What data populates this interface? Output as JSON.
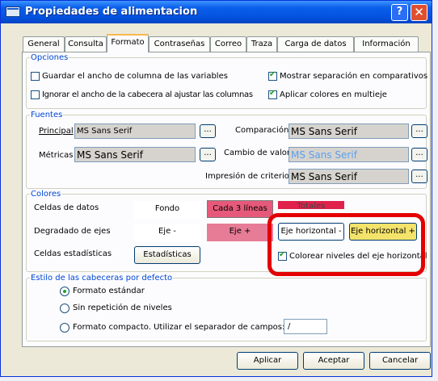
{
  "window": {
    "title": "Propiedades de alimentacion",
    "help_label": "?",
    "close_label": "✕"
  },
  "tabs": [
    "General",
    "Consulta",
    "Formato",
    "Contraseñas",
    "Correo",
    "Traza",
    "Carga de datos",
    "Información"
  ],
  "active_tab": "Formato",
  "opciones": {
    "legend": "Opciones",
    "guardar_ancho": {
      "label": "Guardar el ancho de columna de las variables",
      "checked": false
    },
    "mostrar_sep": {
      "label": "Mostrar separación en comparativos",
      "checked": true
    },
    "ignorar_ancho": {
      "label": "Ignorar el ancho de la cabecera al ajustar las columnas",
      "checked": false
    },
    "aplicar_colores": {
      "label": "Aplicar colores en multieje",
      "checked": true
    }
  },
  "fuentes": {
    "legend": "Fuentes",
    "principal": {
      "label": "Principal",
      "value": "MS Sans Serif"
    },
    "comparacion": {
      "label": "Comparación",
      "value": "MS Sans Serif"
    },
    "metricas": {
      "label": "Métricas",
      "value": "MS Sans Serif"
    },
    "cambio_valor": {
      "label": "Cambio de valor",
      "value": "MS Sans Serif"
    },
    "impresion": {
      "label": "Impresión de criterios",
      "value": "MS Sans Serif"
    },
    "dots_label": "..."
  },
  "colores": {
    "legend": "Colores",
    "celdas_datos": "Celdas de datos",
    "degradado_ejes": "Degradado de ejes",
    "celdas_estadisticas": "Celdas estadísticas",
    "fondo": {
      "label": "Fondo",
      "color": "#ffffff"
    },
    "cada3": {
      "label": "Cada 3 líneas",
      "color": "#e6597a"
    },
    "totales": {
      "label": "Totales",
      "color": "#e0214b"
    },
    "eje_minus": {
      "label": "Eje -",
      "color": "#ffffff"
    },
    "eje_plus": {
      "label": "Eje +",
      "color": "#e77c97"
    },
    "eje_h_minus": {
      "label": "Eje horizontal -",
      "color": "#ffffff"
    },
    "eje_h_plus": {
      "label": "Eje horizontal +",
      "color": "#f4e36a"
    },
    "estadisticas": "Estadísticas",
    "colorear": {
      "label": "Colorear niveles del eje horizontal",
      "checked": true
    }
  },
  "estilo": {
    "legend": "Estilo de las cabeceras por defecto",
    "opt1": {
      "label": "Formato estándar",
      "selected": true
    },
    "opt2": {
      "label": "Sin repetición de niveles",
      "selected": false
    },
    "opt3": {
      "label": "Formato compacto. Utilizar el separador de campos:",
      "selected": false
    },
    "separator": "/"
  },
  "buttons": {
    "aplicar": "Aplicar",
    "aceptar": "Aceptar",
    "cancelar": "Cancelar"
  }
}
